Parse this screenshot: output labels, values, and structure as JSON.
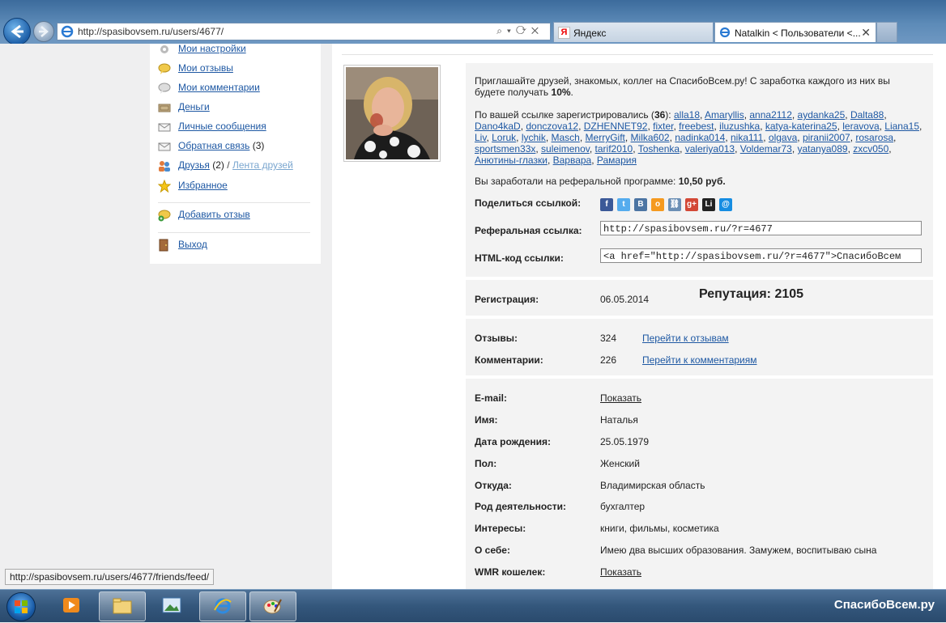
{
  "browser": {
    "url": "http://spasibovsem.ru/users/4677/",
    "tabs": [
      {
        "label": "Яндекс"
      },
      {
        "label": "Natalkin < Пользователи <..."
      }
    ],
    "status_url": "http://spasibovsem.ru/users/4677/friends/feed/"
  },
  "sidebar": {
    "items": [
      {
        "label": "Мои настройки",
        "icon": "gear-icon"
      },
      {
        "label": "Мои отзывы",
        "icon": "speech-bubble-icon"
      },
      {
        "label": "Мои комментарии",
        "icon": "comment-icon"
      },
      {
        "label": "Деньги",
        "icon": "money-icon"
      },
      {
        "label": "Личные сообщения",
        "icon": "envelope-icon"
      },
      {
        "label": "Обратная связь",
        "count": "(3)",
        "icon": "envelope-icon"
      },
      {
        "label": "Друзья",
        "count": "(2)",
        "separator": "/",
        "extra": "Лента друзей",
        "icon": "friends-icon"
      },
      {
        "label": "Избранное",
        "icon": "star-icon"
      },
      {
        "label": "Добавить отзыв",
        "icon": "add-review-icon"
      },
      {
        "label": "Выход",
        "icon": "exit-door-icon"
      }
    ]
  },
  "referral": {
    "invite_text_1": "Приглашайте друзей, знакомых, коллег на СпасибоВсем.ру! С заработка каждого из них вы",
    "invite_text_2": "будете получать ",
    "invite_percent": "10%",
    "invite_end": ".",
    "registered_prefix": "По вашей ссылке зарегистрировались (",
    "registered_count": "36",
    "registered_suffix": "):",
    "users": [
      "alla18",
      "Amaryllis",
      "anna2112",
      "aydanka25",
      "Dalta88",
      "Dano4kaD",
      "donczova12",
      "DZHENNET92",
      "fixter",
      "freebest",
      "iluzushka",
      "katya-katerina25",
      "leravova",
      "Liana15",
      "Liv",
      "Loruk",
      "lychik",
      "Masch",
      "MerryGift",
      "Milka602",
      "nadinka014",
      "nika111",
      "olgava",
      "piranii2007",
      "rosarosa",
      "sportsmen33x",
      "suleimenov",
      "tarif2010",
      "Toshenka",
      "valeriya013",
      "Voldemar73",
      "yatanya089",
      "zxcv050",
      "Анютины-глазки",
      "Варвара",
      "Рамария"
    ],
    "earned_prefix": "Вы заработали на реферальной программе: ",
    "earned_value": "10,50 руб.",
    "share_label": "Поделиться ссылкой:",
    "share_icons": [
      {
        "name": "facebook-icon",
        "glyph": "f",
        "color": "#3b5998"
      },
      {
        "name": "twitter-icon",
        "glyph": "t",
        "color": "#55acee"
      },
      {
        "name": "vkontakte-icon",
        "glyph": "B",
        "color": "#4c75a3"
      },
      {
        "name": "odnoklassniki-icon",
        "glyph": "o",
        "color": "#f59a1f"
      },
      {
        "name": "link-icon",
        "glyph": "⛓",
        "color": "#6b8fb5"
      },
      {
        "name": "google-plus-icon",
        "glyph": "g+",
        "color": "#d34836"
      },
      {
        "name": "livejournal-icon",
        "glyph": "Li",
        "color": "#222222"
      },
      {
        "name": "mail-ru-icon",
        "glyph": "@",
        "color": "#168de2"
      }
    ],
    "ref_link_label": "Реферальная ссылка:",
    "ref_link_value": "http://spasibovsem.ru/?r=4677",
    "html_code_label": "HTML-код ссылки:",
    "html_code_value": "<a href=\"http://spasibovsem.ru/?r=4677\">СпасибоВсем"
  },
  "stats": {
    "reg_label": "Регистрация:",
    "reg_date": "06.05.2014",
    "reputation": "Репутация: 2105",
    "reviews_label": "Отзывы:",
    "reviews_count": "324",
    "reviews_link": "Перейти к отзывам",
    "comments_label": "Комментарии:",
    "comments_count": "226",
    "comments_link": "Перейти к комментариям"
  },
  "profile": {
    "fields": [
      {
        "label": "E-mail:",
        "value": "Показать",
        "is_link": true
      },
      {
        "label": "Имя:",
        "value": "Наталья"
      },
      {
        "label": "Дата рождения:",
        "value": "25.05.1979"
      },
      {
        "label": "Пол:",
        "value": "Женский"
      },
      {
        "label": "Откуда:",
        "value": "Владимирская область"
      },
      {
        "label": "Род деятельности:",
        "value": "бухгалтер"
      },
      {
        "label": "Интересы:",
        "value": "книги, фильмы, косметика"
      },
      {
        "label": "О себе:",
        "value": "Имею два высших образования. Замужем, воспитываю сына"
      },
      {
        "label": "WMR кошелек:",
        "value": "Показать",
        "is_link": true
      }
    ]
  },
  "taskbar": {
    "apps": [
      "media-player-icon",
      "file-explorer-icon",
      "photo-viewer-icon",
      "internet-explorer-icon",
      "paint-icon"
    ],
    "watermark": "СпасибоВсем.ру"
  }
}
